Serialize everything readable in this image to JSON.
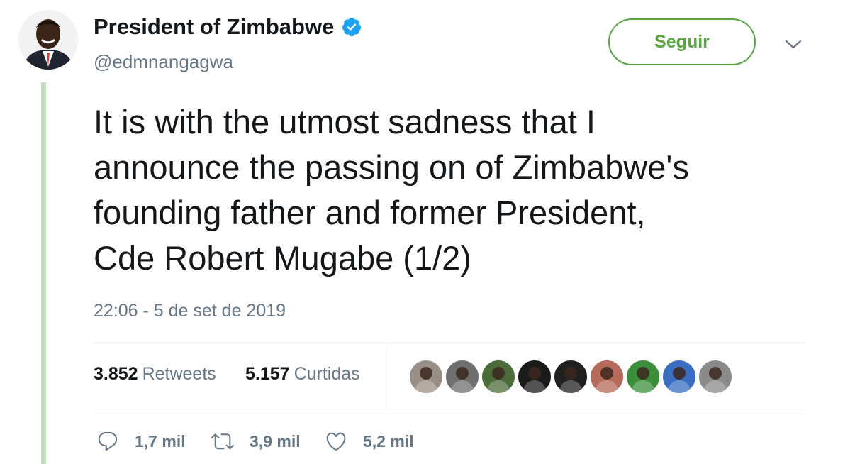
{
  "user": {
    "display_name": "President of Zimbabwe",
    "handle": "@edmnangagwa",
    "verified": true,
    "avatar_icon": "avatar"
  },
  "follow_button": {
    "label": "Seguir"
  },
  "menu": {
    "icon": "chevron-down-icon"
  },
  "tweet": {
    "text": "It is with the utmost sadness that I\nannounce the passing on of Zimbabwe's\nfounding father and former President,\nCde Robert Mugabe (1/2)",
    "timestamp": "22:06 - 5 de set de 2019"
  },
  "stats": {
    "retweets_count": "3.852",
    "retweets_label": "Retweets",
    "likes_count": "5.157",
    "likes_label": "Curtidas"
  },
  "likers": [
    {
      "bg": "#9a8f86"
    },
    {
      "bg": "#6f6f6f"
    },
    {
      "bg": "#4c6b3a"
    },
    {
      "bg": "#1a1a1a"
    },
    {
      "bg": "#202020"
    },
    {
      "bg": "#b56a5a"
    },
    {
      "bg": "#3b8f3a"
    },
    {
      "bg": "#3a6ec0"
    },
    {
      "bg": "#8a8a8a"
    }
  ],
  "actions": {
    "reply_count": "1,7 mil",
    "retweet_count": "3,9 mil",
    "like_count": "5,2 mil"
  },
  "colors": {
    "accent": "#5aa544",
    "verified": "#1da1f2",
    "thread_line": "#c4dfc0",
    "muted": "#657786"
  }
}
